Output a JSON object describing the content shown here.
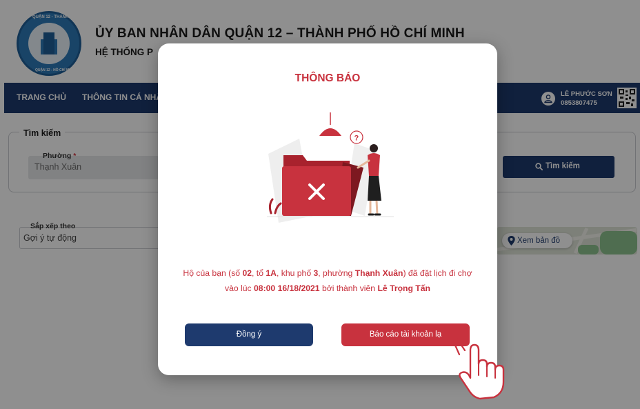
{
  "header": {
    "logo": {
      "text_top": "QUẬN 12 - THÀNH PHỐ HỒ CHÍ MINH",
      "text_bottom": "QUẬN 12 - HỒ CHÍ MINH CITY"
    },
    "title": "ỦY BAN NHÂN DÂN QUẬN 12 – THÀNH PHỐ HỒ CHÍ MINH",
    "subtitle": "HỆ THỐNG P"
  },
  "nav": {
    "items": [
      "TRANG CHỦ",
      "THÔNG TIN CÁ NHÂ"
    ],
    "user_name": "LÊ PHƯỚC SƠN",
    "user_phone": "0853807475"
  },
  "search": {
    "legend": "Tìm kiếm",
    "ward_label": "Phường",
    "ward_required": "*",
    "ward_value": "Thạnh Xuân",
    "button_label": "Tìm kiếm"
  },
  "sort": {
    "label": "Sắp xếp theo",
    "value": "Gợi ý tự động"
  },
  "map": {
    "button_label": "Xem bản đồ"
  },
  "modal": {
    "title": "THÔNG BÁO",
    "message": {
      "p1": "Hộ của bạn (số ",
      "house_no": "02",
      "p2": ", tổ ",
      "group": "1A",
      "p3": ", khu phố ",
      "quarter": "3",
      "p4": ", phường ",
      "ward": "Thạnh Xuân",
      "p5": ") đã đặt lịch đi chợ vào lúc ",
      "datetime": "08:00 16/18/2021",
      "p6": " bởi thành viên ",
      "member": "Lê Trọng Tấn"
    },
    "confirm_label": "Đồng ý",
    "report_label": "Báo cáo tài khoản lạ"
  },
  "colors": {
    "navy": "#1e3a6e",
    "accent_red": "#c8323e",
    "overlay": "rgba(0,0,0,0.44)"
  },
  "icons": [
    "logo-emblem",
    "user-icon",
    "qr-code-icon",
    "search-icon",
    "map-pin-icon",
    "folder-error-illustration",
    "pointing-hand-icon"
  ]
}
